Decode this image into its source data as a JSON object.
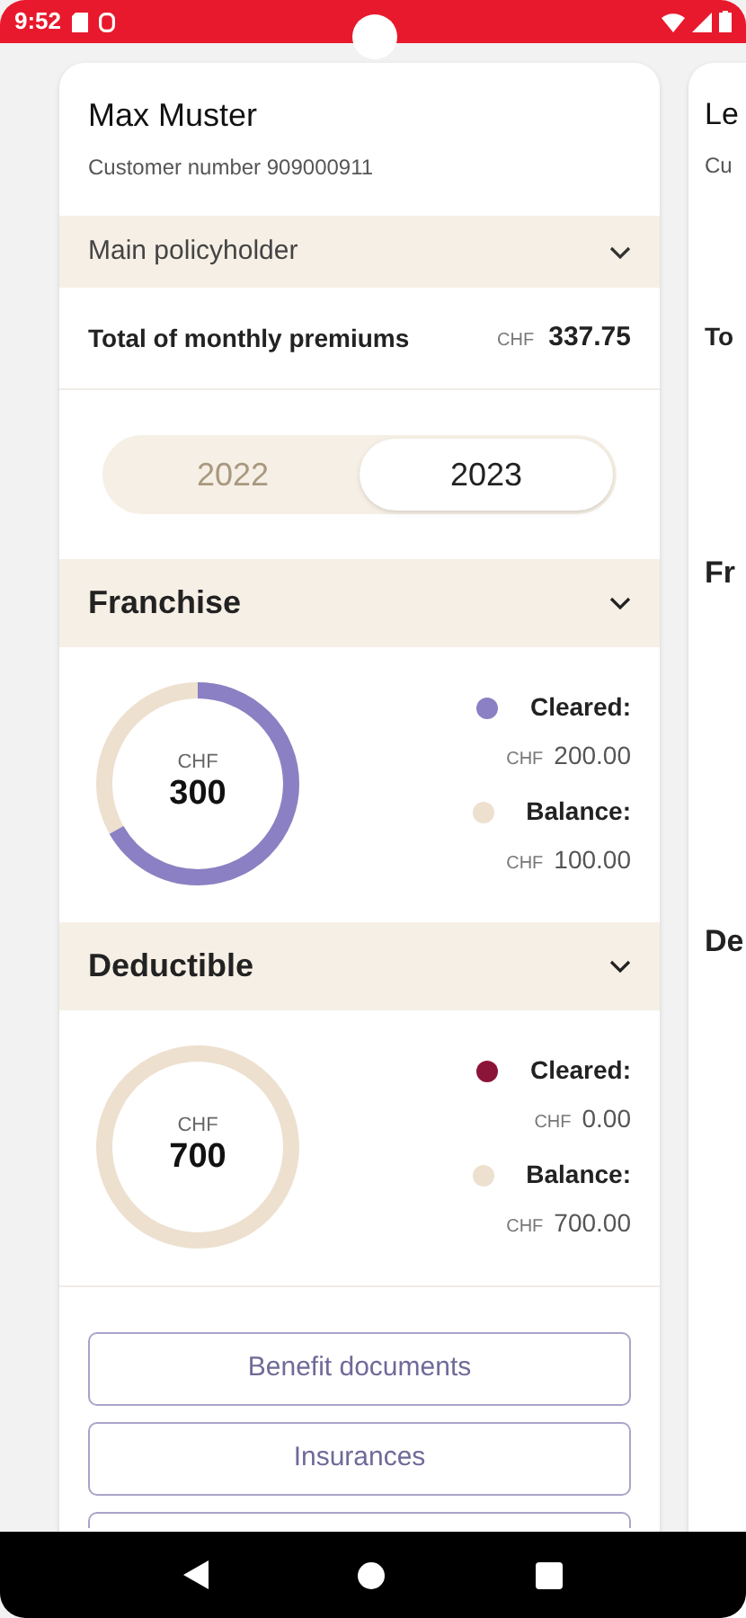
{
  "status_bar": {
    "time": "9:52"
  },
  "card": {
    "name": "Max Muster",
    "customer_number": "Customer number 909000911",
    "role": {
      "label": "Main policyholder",
      "expanded": false
    },
    "premiums": {
      "label": "Total of monthly premiums",
      "currency": "CHF",
      "amount": "337.75"
    },
    "years": [
      {
        "label": "2022",
        "selected": false
      },
      {
        "label": "2023",
        "selected": true
      }
    ],
    "sections": [
      {
        "title": "Franchise",
        "expanded": true,
        "currency": "CHF",
        "total": "300",
        "level": 0.667,
        "legend": [
          {
            "label": "Cleared:",
            "color": "#8b80c4",
            "currency": "CHF",
            "amount": "200.00"
          },
          {
            "label": "Balance:",
            "color": "#ede0cf",
            "currency": "CHF",
            "amount": "100.00"
          }
        ]
      },
      {
        "title": "Deductible",
        "expanded": true,
        "currency": "CHF",
        "total": "700",
        "level": 0,
        "legend": [
          {
            "label": "Cleared:",
            "color": "#8b1538",
            "currency": "CHF",
            "amount": "0.00"
          },
          {
            "label": "Balance:",
            "color": "#ede0cf",
            "currency": "CHF",
            "amount": "700.00"
          }
        ]
      }
    ],
    "buttons": [
      "Benefit documents",
      "Insurances"
    ]
  },
  "next_card": {
    "name": "Le",
    "customer_number": "Cu",
    "premiums_label": "To",
    "sections": [
      "Fr",
      "De"
    ]
  }
}
